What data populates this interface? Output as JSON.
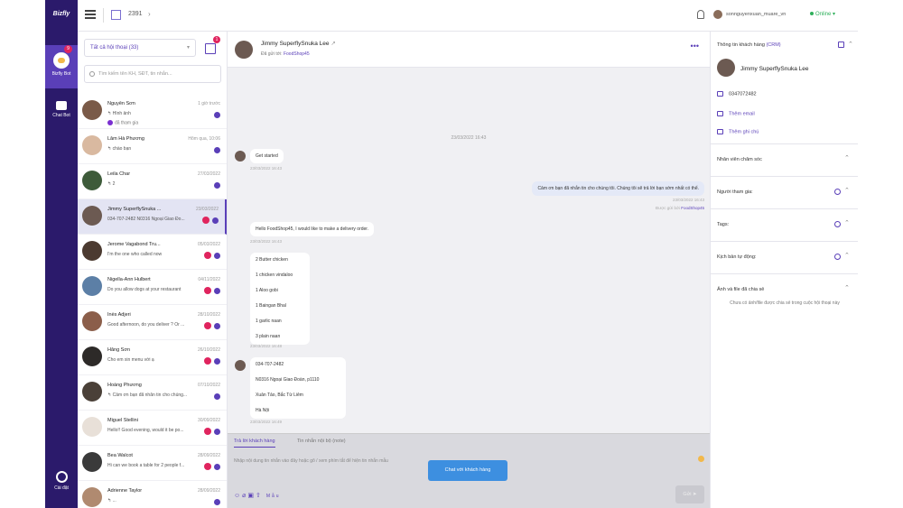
{
  "nav": {
    "logo": "Bizfly",
    "items": [
      {
        "label": "Bizfly Bot",
        "badge": "9"
      },
      {
        "label": "Chat Bot"
      },
      {
        "label": "Cài đặt"
      }
    ]
  },
  "topbar": {
    "count": "2391",
    "user": "sonnguyenxuan_muare_vn",
    "status": "Online"
  },
  "conversations": {
    "filter": "Tất cả hội thoại (33)",
    "filter_badge": "1",
    "search_placeholder": "Tìm kiếm tên KH, SĐT, tin nhắn...",
    "items": [
      {
        "name": "Nguyễn Sơn",
        "time": "1 giờ trước",
        "message": "↰ Hình ảnh",
        "sub": "đã tham gia",
        "avatar_color": "#7a5a48",
        "unread": false
      },
      {
        "name": "Lâm Hà Phương",
        "time": "Hôm qua, 10:06",
        "message": "↰ chào bạn",
        "avatar_color": "#d9b9a0",
        "unread": false
      },
      {
        "name": "Leila Char",
        "time": "27/03/2022",
        "message": "↰ 2",
        "avatar_color": "#3e5b3a",
        "unread": false
      },
      {
        "name": "Jimmy SuperflySnuka ...",
        "time": "23/03/2022",
        "message": "034-707-2482 N0316 Ngoại Giao Đo...",
        "avatar_color": "#6c5a52",
        "unread": true
      },
      {
        "name": "Jerome Vagabond Tru...",
        "time": "05/03/2022",
        "message": "I'm the one who called now",
        "avatar_color": "#4b3a30",
        "unread": true
      },
      {
        "name": "Nigella-Ann Hulbert",
        "time": "04/11/2022",
        "message": "Do you allow dogs at your restaurant",
        "avatar_color": "#5c7fa6",
        "unread": true
      },
      {
        "name": "Inès Adjeri",
        "time": "28/10/2022",
        "message": "Good afternoon, do you deliver ? Or ...",
        "avatar_color": "#8b5e4a",
        "unread": true
      },
      {
        "name": "Hằng Sơn",
        "time": "26/10/2022",
        "message": "Cho em xin menu với ạ",
        "avatar_color": "#2d2a28",
        "unread": true
      },
      {
        "name": "Hoàng Phương",
        "time": "07/10/2022",
        "message": "↰ Cảm ơn bạn đã nhắn tin cho chúng...",
        "avatar_color": "#4a4038",
        "unread": false
      },
      {
        "name": "Miguel Stellini",
        "time": "30/09/2022",
        "message": "Hello!! Good evening, would it be po...",
        "avatar_color": "#e8e0d8",
        "unread": true
      },
      {
        "name": "Bea Walcot",
        "time": "28/09/2022",
        "message": "Hi can we book a table for 2 people f...",
        "avatar_color": "#3a3a3a",
        "unread": true
      },
      {
        "name": "Adrienne Taylor",
        "time": "28/09/2022",
        "message": "↰ ...",
        "avatar_color": "#b08a70",
        "unread": false
      }
    ]
  },
  "chat": {
    "name": "Jimmy SuperflySnuka Lee",
    "sub_prefix": "Đã gửi tới:",
    "sub_link": "FoodShop45",
    "date_divider": "23/03/2022 16:43",
    "messages": {
      "m1": "Get started",
      "m1_time": "23/03/2022 16:43",
      "m2": "Cảm ơn bạn đã nhắn tin cho chúng tôi. Chúng tôi sẽ trả lời bạn sớm nhất có thể.",
      "m2_time": "23/03/2022 16:43",
      "m2_sent_prefix": "Được gửi bởi",
      "m2_sent_link": "FoodShop45",
      "m3": "Hello FoodShop45, I would like to make a delivery order.",
      "m3_time": "23/03/2022 16:43",
      "order": [
        "2 Butter chicken",
        "1 chicken vindaloo",
        "1 Aloo gobi",
        "1 Baingan Bhal",
        "1 garlic naan",
        "3 plain naan"
      ],
      "order_time": "23/03/2022 16:48",
      "address": [
        "034-707-2482",
        "N0316 Ngoại Giao Đoàn, p1110",
        "Xuân Tảo, Bắc Từ Liêm",
        "Hà Nội"
      ],
      "address_time": "23/03/2022 16:49"
    },
    "composer": {
      "tab_reply": "Trả lời khách hàng",
      "tab_note": "Tin nhắn nội bộ (note)",
      "placeholder": "Nhập nội dung tin nhắn vào đây hoặc gõ / xem phím tắt để hiện tin nhắn mẫu",
      "tools_label": "Mẫu",
      "send": "Gửi ➤",
      "chat_with_customer": "Chat với khách hàng"
    }
  },
  "info": {
    "title": "Thông tin khách hàng",
    "title_link": "(CRM)",
    "name": "Jimmy SuperflySnuka Lee",
    "phone": "0347072482",
    "add_email": "Thêm email",
    "add_note": "Thêm ghi chú",
    "sections": [
      "Nhân viên chăm sóc",
      "Người tham gia:",
      "Tags:",
      "Kịch bản tự động:",
      "Ảnh và file đã chia sẻ"
    ],
    "empty": "Chưa có ảnh/file được chia sẻ trong cuộc hội thoại này"
  }
}
